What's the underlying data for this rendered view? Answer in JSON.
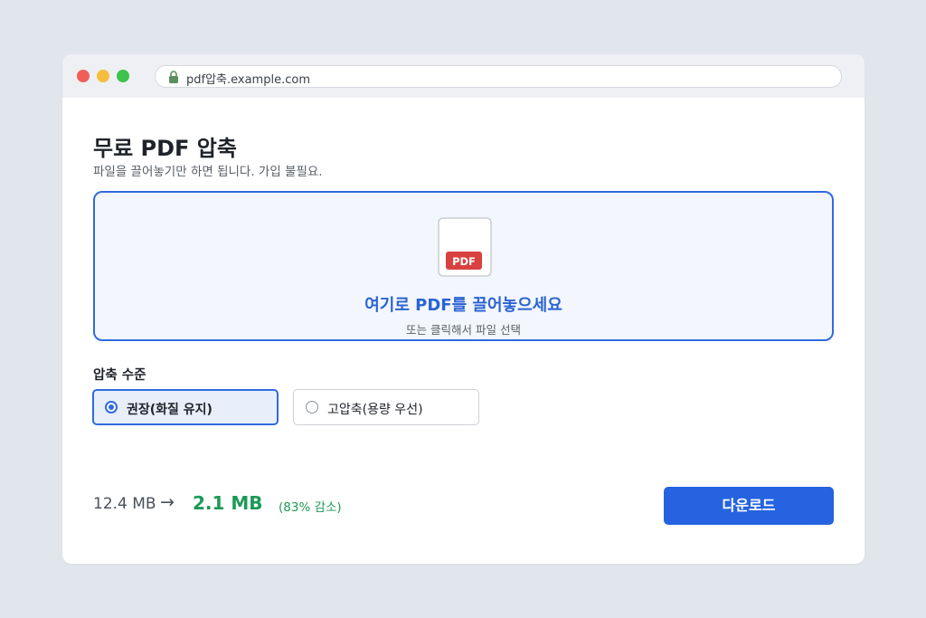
{
  "browser": {
    "url": "pdf압축.example.com",
    "icons": {
      "lock": "lock-icon"
    }
  },
  "page": {
    "title": "무료 PDF 압축",
    "subtitle": "파일을 끌어놓기만 하면 됩니다. 가입 불필요."
  },
  "dropzone": {
    "file_badge": "PDF",
    "title": "여기로 PDF를 끌어놓으세요",
    "hint": "또는 클릭해서 파일 선택",
    "icon": "pdf-file-icon"
  },
  "compression": {
    "label": "압축 수준",
    "options": [
      {
        "label": "권장(화질 유지)",
        "selected": true
      },
      {
        "label": "고압축(용량 우선)",
        "selected": false
      }
    ]
  },
  "result": {
    "original_size": "12.4 MB",
    "arrow": "→",
    "compressed_size": "2.1 MB",
    "reduction": "(83% 감소)"
  },
  "actions": {
    "download_label": "다운로드"
  },
  "colors": {
    "accent": "#2563e0",
    "success": "#1d9957",
    "pdf_badge": "#d94040"
  }
}
